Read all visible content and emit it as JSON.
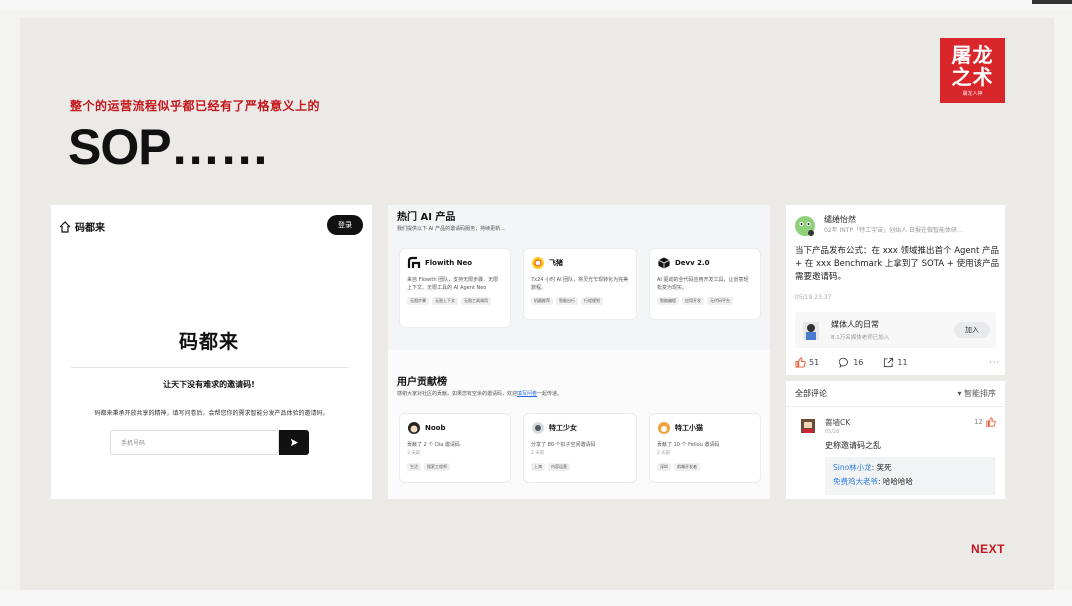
{
  "slide": {
    "kicker": "整个的运营流程似乎都已经有了严格意义上的",
    "headline": "SOP……",
    "logo_line1": "屠龙",
    "logo_line2": "之术",
    "logo_tagline": "屠龙人神",
    "next_label": "NEXT",
    "accent_color": "#c4161c"
  },
  "panel1": {
    "brand": "码都来",
    "login_label": "登录",
    "title": "码都来",
    "subtitle": "让天下没有难求的邀请码!",
    "description": "码都来秉承开放共享的精神，填写问卷后，会帮您你的需求智能分发产品体验的邀请码。",
    "phone_placeholder": "手机号码"
  },
  "panel2": {
    "hot_title": "热门 AI 产品",
    "hot_sub": "我们提供以下 AI 产品的邀请码服务，持续更新...",
    "products": [
      {
        "name": "Flowith Neo",
        "desc": "来自 Flowith 团队，支持无限步骤、无限上下文、无限工具的 AI Agent Neo",
        "tags": [
          "无限步骤",
          "无限上下文",
          "无限工具调用"
        ]
      },
      {
        "name": "飞猪",
        "desc": "7x24 小时 AI 团队，将灵光乍现转化为完美旅程。",
        "tags": [
          "机器推荐",
          "智能出行",
          "行程规划"
        ]
      },
      {
        "name": "Devv 2.0",
        "desc": "AI 驱动的全代码应用开发工具，让创意轻松变为现实。",
        "tags": [
          "智能编程",
          "应用开发",
          "无代码平台"
        ]
      }
    ],
    "rank_title": "用户贡献榜",
    "rank_sub_prefix": "感谢大家对社区的贡献。如果您有空余的邀请码，欢迎",
    "rank_sub_link": "填写问卷",
    "rank_sub_suffix": "一起传递。",
    "contributors": [
      {
        "name": "Noob",
        "desc": "贡献了 2 个 Dia 邀请码",
        "time": "3 天前",
        "tags": [
          "生活",
          "搜索工程师"
        ]
      },
      {
        "name": "特工少女",
        "desc": "分享了 80 个扣子空间邀请码",
        "time": "2 天前",
        "tags": [
          "上海",
          "内容运营"
        ]
      },
      {
        "name": "特工小猫",
        "desc": "贡献了 10 个 Fellou 邀请码",
        "time": "2 天前",
        "tags": [
          "深圳",
          "前端开发者"
        ]
      }
    ]
  },
  "panel3": {
    "user_name": "缱绻怡然",
    "user_meta": "02年 INTP「特工宇宙」创始人 日报在做智能体研…",
    "post_text": "当下产品发布公式：在 xxx 领域推出首个 Agent 产品 + 在 xxx Benchmark 上拿到了 SOTA + 使用该产品需要邀请码。",
    "post_time": "05/19 23:37",
    "circle_name": "媒体人的日常",
    "circle_sub": "8.1万名媒体老师已加入",
    "join_label": "加入",
    "likes": "51",
    "comments": "16",
    "shares": "11",
    "more": "···",
    "comments_header": "全部评论",
    "sort_label": "▾ 智能排序",
    "comment": {
      "name": "蔷墙CK",
      "date": "05/20",
      "likes": "12",
      "text": "史称邀请码之乱"
    },
    "replies": [
      {
        "who": "Sino林小龙",
        "text": ": 笑死"
      },
      {
        "who": "免费鸡大老爷",
        "text": ": 哈哈哈哈"
      }
    ],
    "like_color": "#e8542c",
    "link_color": "#2a7ee0"
  }
}
